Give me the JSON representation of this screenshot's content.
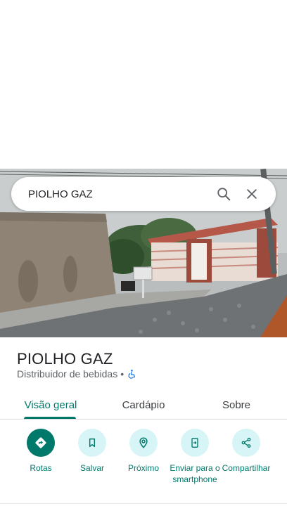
{
  "search": {
    "query": "PIOLHO GAZ"
  },
  "place": {
    "title": "PIOLHO GAZ",
    "category": "Distribuidor de bebidas",
    "separator": "•"
  },
  "tabs": [
    {
      "label": "Visão geral",
      "selected": true
    },
    {
      "label": "Cardápio",
      "selected": false
    },
    {
      "label": "Sobre",
      "selected": false
    }
  ],
  "actions": [
    {
      "label": "Rotas",
      "icon": "directions-icon"
    },
    {
      "label": "Salvar",
      "icon": "bookmark-icon"
    },
    {
      "label": "Próximo",
      "icon": "nearby-icon"
    },
    {
      "label": "Enviar para o smartphone",
      "icon": "send-to-phone-icon"
    },
    {
      "label": "Compartilhar",
      "icon": "share-icon"
    }
  ],
  "colors": {
    "accent": "#00796b",
    "action_bg": "#d7f5f6",
    "text": "#202124",
    "muted": "#5f6368"
  }
}
